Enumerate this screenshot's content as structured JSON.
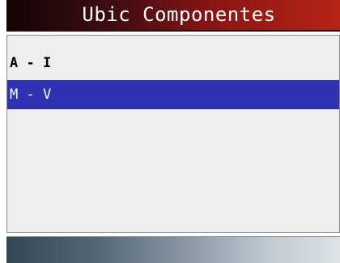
{
  "header": {
    "title": "Ubic Componentes"
  },
  "menu": {
    "items": [
      {
        "label": "A - I",
        "selected": false
      },
      {
        "label": "M - V",
        "selected": true
      }
    ]
  },
  "colors": {
    "title_gradient_start": "#120405",
    "title_gradient_end": "#b52416",
    "selection": "#2f32b3",
    "list_background": "#efefef"
  }
}
